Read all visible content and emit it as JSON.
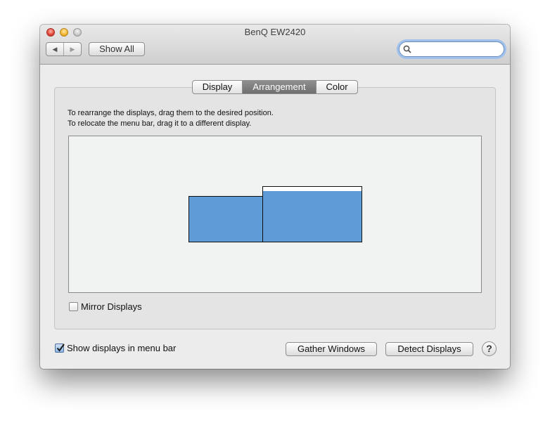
{
  "window": {
    "title": "BenQ EW2420"
  },
  "toolbar": {
    "back_glyph": "◀",
    "forward_glyph": "▶",
    "show_all_label": "Show All",
    "search_placeholder": ""
  },
  "tabs": [
    {
      "label": "Display",
      "active": false
    },
    {
      "label": "Arrangement",
      "active": true
    },
    {
      "label": "Color",
      "active": false
    }
  ],
  "arrangement": {
    "instruction_line1": "To rearrange the displays, drag them to the desired position.",
    "instruction_line2": "To relocate the menu bar, drag it to a different display.",
    "display_color": "#5f9bd6"
  },
  "mirror_displays": {
    "label": "Mirror Displays",
    "checked": false
  },
  "show_in_menu_bar": {
    "label": "Show displays in menu bar",
    "checked": true
  },
  "buttons": {
    "gather_windows": "Gather Windows",
    "detect_displays": "Detect Displays",
    "help": "?"
  },
  "icons": {
    "search": "magnifier-icon",
    "help": "question-mark-icon"
  }
}
